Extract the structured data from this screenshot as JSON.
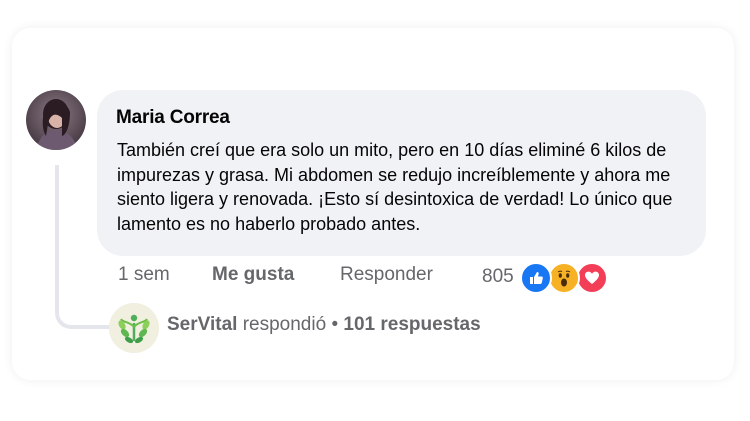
{
  "comment": {
    "author": "Maria Correa",
    "text": "También creí que era solo un mito, pero en 10 días eliminé 6 kilos de impurezas y grasa. Mi abdomen se redujo increíblemente y ahora me siento ligera y renovada. ¡Esto sí desintoxica de verdad! Lo único que lamento es no haberlo probado antes.",
    "timestamp": "1 sem",
    "like_label": "Me gusta",
    "reply_label": "Responder",
    "reaction_count": "805",
    "reactions": [
      "like-icon",
      "wow-icon",
      "love-icon"
    ]
  },
  "reply_summary": {
    "page_name": "SerVital",
    "action": "respondió",
    "separator": "•",
    "replies": "101 respuestas"
  },
  "colors": {
    "bubble": "#f0f2f5",
    "secondary_text": "#65676b",
    "like_blue": "#1877f2",
    "love_red": "#f33e58",
    "wow_yellow": "#f7b125"
  }
}
